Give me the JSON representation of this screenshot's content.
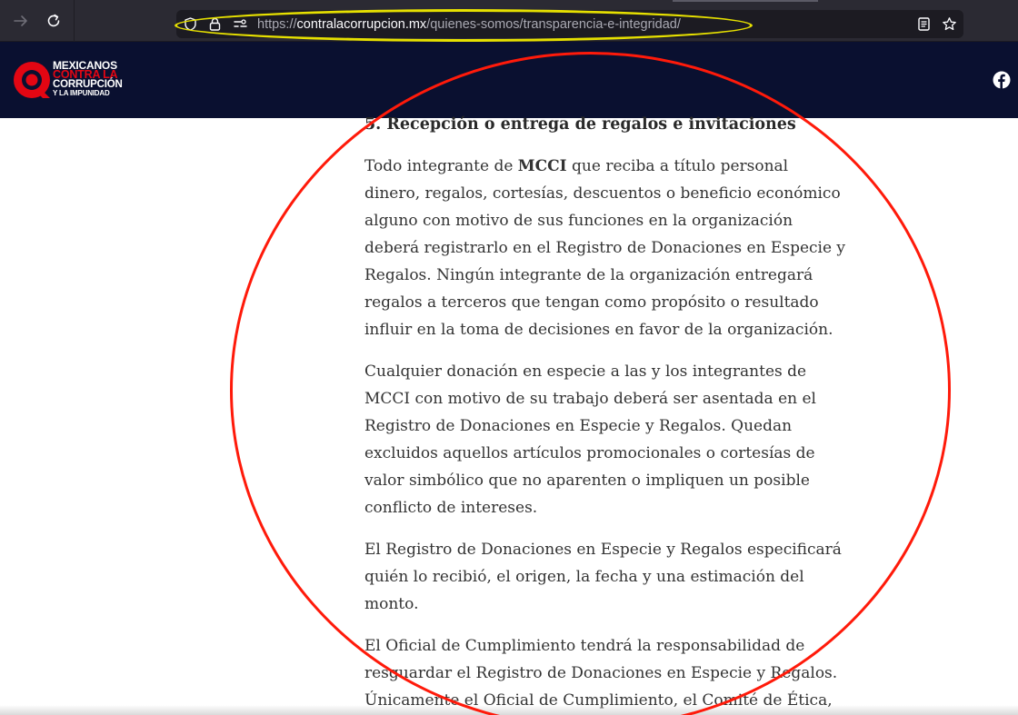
{
  "browser": {
    "url_protocol": "https://",
    "url_host": "contralacorrupcion.mx",
    "url_path": "/quienes-somos/transparencia-e-integridad/"
  },
  "site": {
    "logo_line1": "MEXICANOS",
    "logo_line2": "CONTRA LA",
    "logo_line3": "CORRUPCIÓN",
    "logo_line4": "Y LA IMPUNIDAD",
    "brand_red": "#e30613",
    "header_bg": "#0a1030"
  },
  "article": {
    "heading": "5. Recepción o entrega de regalos e invitaciones",
    "p1_pre": "Todo integrante de ",
    "p1_bold": "MCCI",
    "p1_post": " que reciba a título personal dinero, regalos, cortesías, descuentos o beneficio económico alguno con motivo de sus funciones en la organización deberá registrarlo en el Registro de Donaciones en Especie y Regalos. Ningún integrante de la organización entregará regalos a terceros que tengan como propósito o resultado influir en la toma de decisiones en favor de la organización.",
    "p2": "Cualquier donación en especie a las y los  integrantes de MCCI con motivo de su trabajo deberá ser asentada en el Registro de Donaciones en Especie y Regalos. Quedan excluidos aquellos artículos promocionales o cortesías de valor simbólico que no aparenten o impliquen un posible conflicto de intereses.",
    "p3": "El Registro de Donaciones en Especie y Regalos especificará quién lo recibió, el origen, la fecha y una estimación del monto.",
    "p4": "El Oficial de Cumplimiento tendrá la responsabilidad de resguardar el Registro de Donaciones en Especie y Regalos. Únicamente el Oficial de Cumplimiento, el Comité de Ética,"
  }
}
